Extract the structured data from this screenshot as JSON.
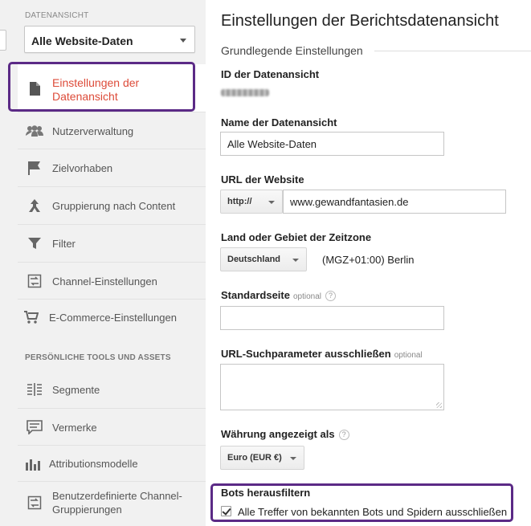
{
  "sidebar": {
    "view_section_label": "DATENANSICHT",
    "view_selector": "Alle Website-Daten",
    "items": [
      {
        "label": "Einstellungen der Datenansicht",
        "icon": "document-icon",
        "active": true
      },
      {
        "label": "Nutzerverwaltung",
        "icon": "users-icon"
      },
      {
        "label": "Zielvorhaben",
        "icon": "flag-icon"
      },
      {
        "label": "Gruppierung nach Content",
        "icon": "content-grouping-icon"
      },
      {
        "label": "Filter",
        "icon": "filter-icon"
      },
      {
        "label": "Channel-Einstellungen",
        "icon": "channel-icon"
      },
      {
        "label": "E-Commerce-Einstellungen",
        "icon": "cart-icon"
      }
    ],
    "tools_section_label": "PERSÖNLICHE TOOLS UND ASSETS",
    "tools": [
      {
        "label": "Segmente",
        "icon": "segments-icon"
      },
      {
        "label": "Vermerke",
        "icon": "annotation-icon"
      },
      {
        "label": "Attributionsmodelle",
        "icon": "bar-chart-icon"
      },
      {
        "label": "Benutzerdefinierte Channel-Gruppierungen",
        "icon": "channel-icon"
      }
    ]
  },
  "main": {
    "title": "Einstellungen der Berichtsdatenansicht",
    "section": "Grundlegende Einstellungen",
    "view_id_label": "ID der Datenansicht",
    "view_name_label": "Name der Datenansicht",
    "view_name_value": "Alle Website-Daten",
    "url_label": "URL der Website",
    "protocol": "http://",
    "url_value": "www.gewandfantasien.de",
    "timezone_label": "Land oder Gebiet der Zeitzone",
    "country": "Deutschland",
    "timezone": "(MGZ+01:00) Berlin",
    "default_page_label": "Standardseite",
    "optional": "optional",
    "exclude_params_label": "URL-Suchparameter ausschließen",
    "currency_label": "Währung angezeigt als",
    "currency": "Euro (EUR €)",
    "bots_label": "Bots herausfiltern",
    "bots_checkbox_label": "Alle Treffer von bekannten Bots und Spidern ausschließen",
    "bots_checked": true,
    "help_glyph": "?"
  },
  "colors": {
    "active_text": "#dd4b39",
    "highlight_border": "#5b2a86",
    "sidebar_bg": "#f1f1f1"
  }
}
